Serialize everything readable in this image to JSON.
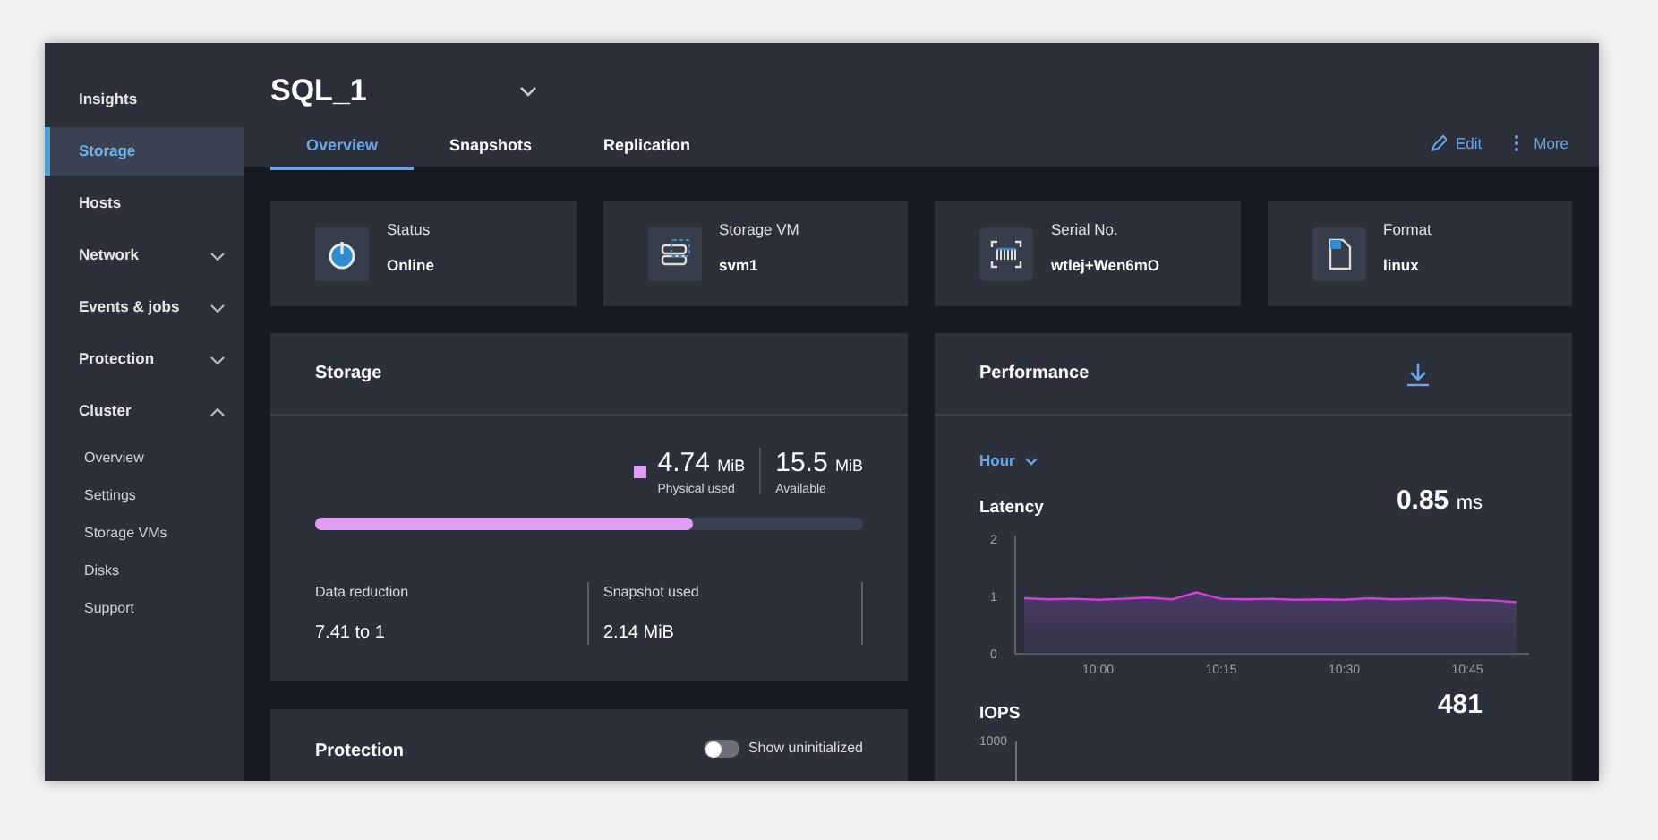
{
  "sidebar": {
    "items": [
      {
        "label": "Insights",
        "selected": false
      },
      {
        "label": "Storage",
        "selected": true
      },
      {
        "label": "Hosts",
        "selected": false
      },
      {
        "label": "Network",
        "selected": false,
        "expanded": false
      },
      {
        "label": "Events & jobs",
        "selected": false,
        "expanded": false
      },
      {
        "label": "Protection",
        "selected": false,
        "expanded": false
      },
      {
        "label": "Cluster",
        "selected": false,
        "expanded": true,
        "children": [
          {
            "label": "Overview"
          },
          {
            "label": "Settings"
          },
          {
            "label": "Storage VMs"
          },
          {
            "label": "Disks"
          },
          {
            "label": "Support"
          }
        ]
      }
    ]
  },
  "header": {
    "title": "SQL_1",
    "tabs": [
      {
        "label": "Overview",
        "selected": true
      },
      {
        "label": "Snapshots",
        "selected": false
      },
      {
        "label": "Replication",
        "selected": false
      }
    ],
    "actions": [
      {
        "kind": "edit",
        "label": "Edit"
      },
      {
        "kind": "more",
        "label": "More"
      }
    ]
  },
  "info_cards": [
    {
      "kind": "status",
      "label": "Status",
      "value": "Online"
    },
    {
      "kind": "svm",
      "label": "Storage VM",
      "value": "svm1"
    },
    {
      "kind": "serial",
      "label": "Serial No.",
      "value": "wtlej+Wen6mO"
    },
    {
      "kind": "format",
      "label": "Format",
      "value": "linux"
    }
  ],
  "storage": {
    "title": "Storage",
    "used": {
      "value": "4.74",
      "unit": "MiB",
      "label": "Physical used"
    },
    "available": {
      "value": "15.5",
      "unit": "MiB",
      "label": "Available"
    },
    "level": 0.69,
    "stats": [
      {
        "label": "Data reduction",
        "value": "7.41 to 1"
      },
      {
        "label": "Snapshot used",
        "value": "2.14 MiB"
      }
    ]
  },
  "protection": {
    "title": "Protection",
    "toggle": {
      "label": "Show uninitialized",
      "on": false
    }
  },
  "performance": {
    "title": "Performance",
    "range": "Hour",
    "latency": {
      "title": "Latency",
      "value": "0.85",
      "unit": "ms",
      "chart_data": {
        "type": "area",
        "categories": [
          null,
          null,
          null,
          "10:00",
          null,
          null,
          null,
          null,
          "10:15",
          null,
          null,
          null,
          null,
          "10:30",
          null,
          null,
          null,
          null,
          "10:45",
          null,
          null
        ],
        "series": [
          {
            "color": "#d63ce0",
            "values": [
              0.97,
              0.95,
              0.96,
              0.94,
              0.96,
              0.98,
              0.95,
              1.07,
              0.96,
              0.95,
              0.96,
              0.94,
              0.95,
              0.94,
              0.97,
              0.95,
              0.96,
              0.97,
              0.94,
              0.93,
              0.9
            ]
          }
        ],
        "ylim": [
          0,
          2
        ],
        "yticks": [
          0,
          1,
          2
        ]
      }
    },
    "iops": {
      "title": "IOPS",
      "value": "481",
      "y_tick": "1000"
    }
  }
}
